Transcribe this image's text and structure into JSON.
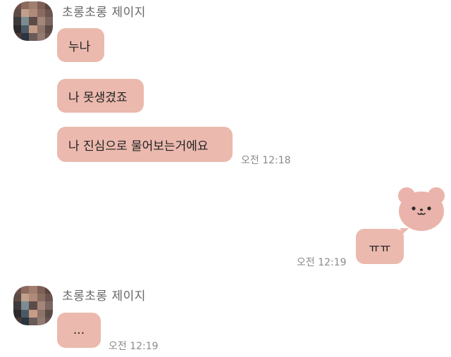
{
  "chat": {
    "messages_group_1": {
      "sender": "초롱초롱 제이지",
      "messages": [
        "누나",
        "나 못생겼죠",
        "나 진심으로 물어보는거에요"
      ],
      "time": "오전 12:18"
    },
    "my_message": {
      "sticker": "bear-face-sticker",
      "text": "ㅠㅠ",
      "time": "오전 12:19"
    },
    "messages_group_2": {
      "sender": "초롱초롱 제이지",
      "messages": [
        "..."
      ],
      "time": "오전 12:19"
    }
  },
  "colors": {
    "bubble": "#ebb9ae",
    "sticker": "#eab3ab",
    "time_text": "#8a8a8a"
  }
}
